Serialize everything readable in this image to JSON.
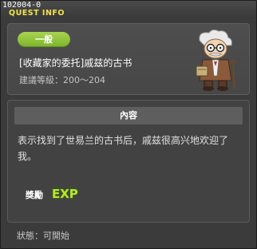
{
  "window": {
    "quest_id": "102004-0",
    "title": "QUEST INFO"
  },
  "quest": {
    "category": "一般",
    "name": "[收藏家的委托]戚兹的古书",
    "recommend_level": "建議等級：200～204"
  },
  "content": {
    "header": "內容",
    "text": "表示找到了世易兰的古书后，戚兹很高兴地欢迎了我。"
  },
  "reward": {
    "label": "獎勵",
    "icon": "exp-icon",
    "icon_text": "EXP"
  },
  "status": {
    "text": "狀態：可開始"
  },
  "colors": {
    "badge": "#8cc63f",
    "title": "#f2e34a",
    "exp": "#b6e62e"
  }
}
